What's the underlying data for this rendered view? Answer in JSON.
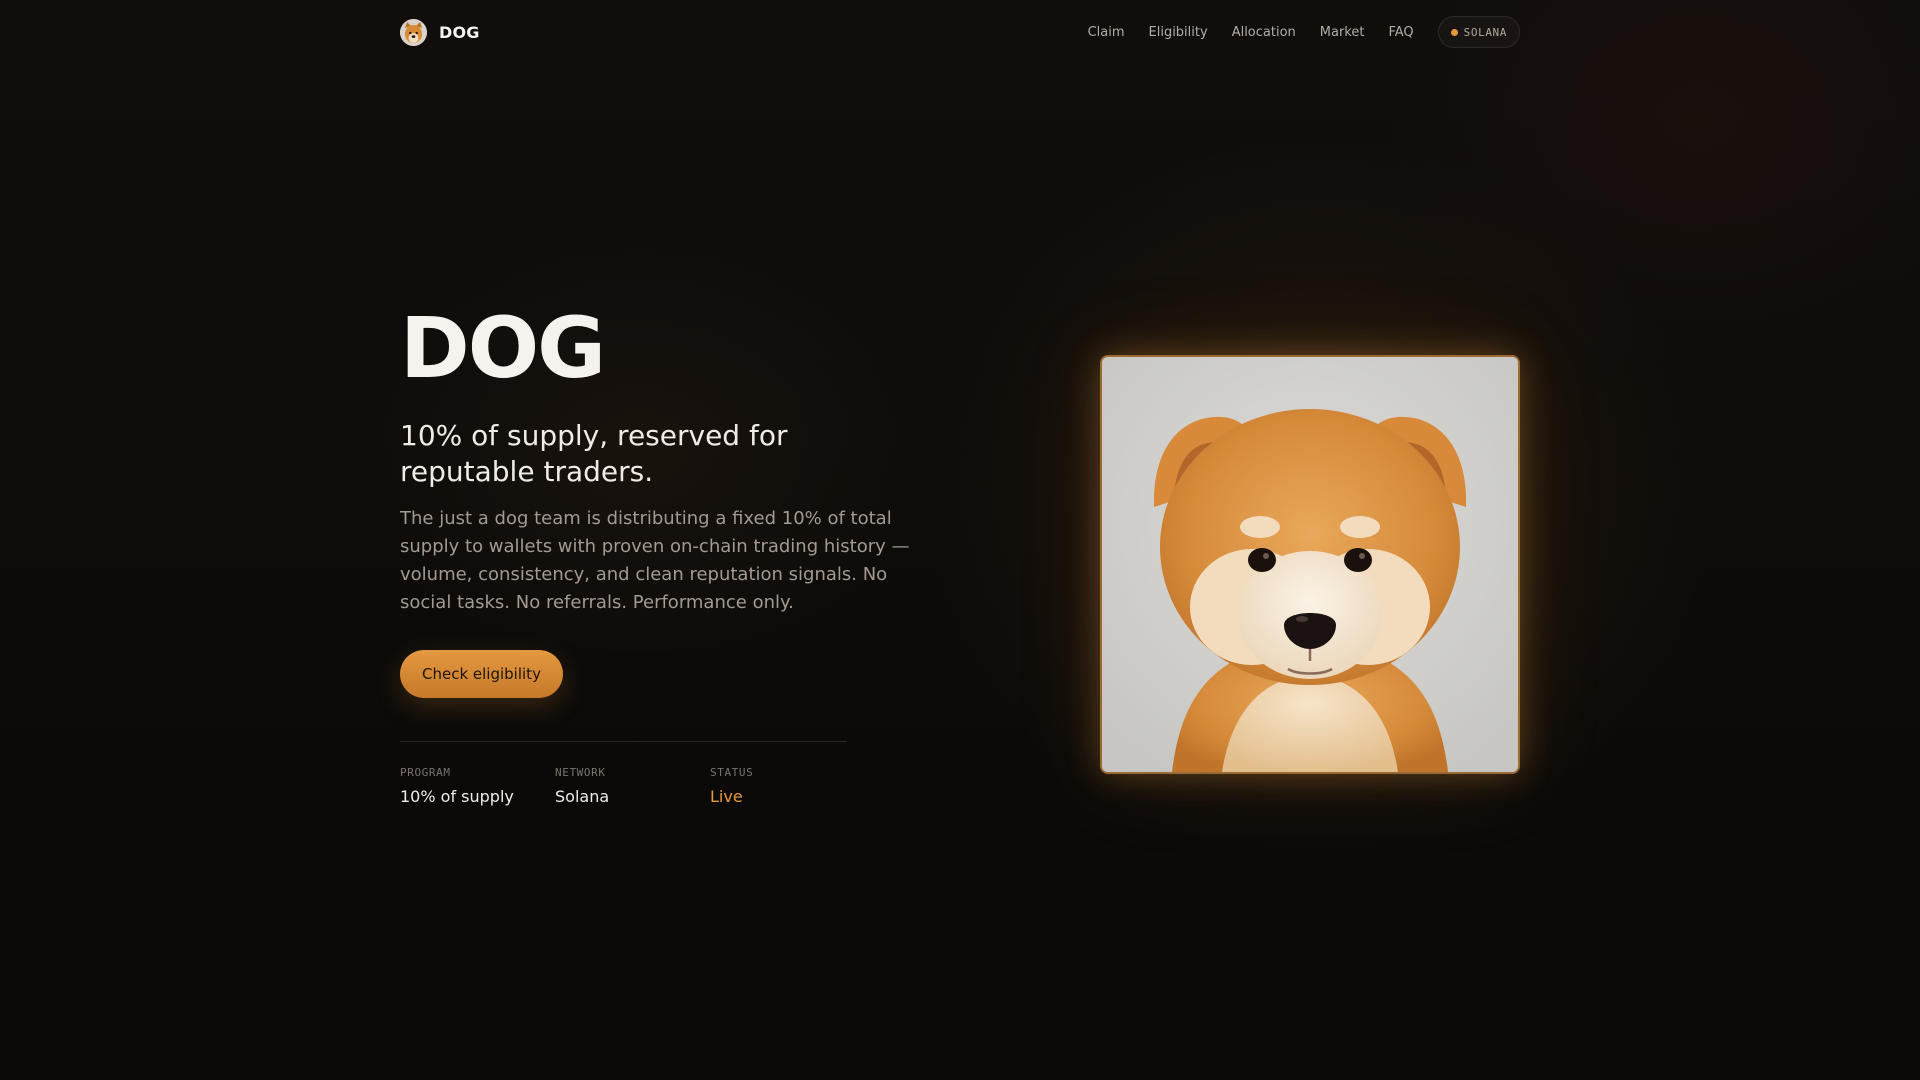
{
  "nav": {
    "brand_name": "DOG",
    "brand_logo_icon": "dog-face-icon",
    "links": [
      "Claim",
      "Eligibility",
      "Allocation",
      "Market",
      "FAQ"
    ],
    "chain_badge": {
      "label": "SOLANA",
      "dot_color": "#e59a3e"
    }
  },
  "hero": {
    "title": "DOG",
    "subtitle": "10% of supply, reserved for reputable traders.",
    "description": "The just a dog team is distributing a fixed 10% of total supply to wallets with proven on-chain trading history — volume, consistency, and clean reputation signals. No social tasks. No referrals. Performance only.",
    "cta_label": "Check eligibility",
    "image_icon": "shiba-puppy-photo"
  },
  "stats": [
    {
      "label": "PROGRAM",
      "value": "10% of supply"
    },
    {
      "label": "NETWORK",
      "value": "Solana"
    },
    {
      "label": "STATUS",
      "value": "Live"
    }
  ],
  "colors": {
    "accent": "#e59a3e",
    "background": "#0b0908",
    "text_muted": "#a39a92"
  }
}
